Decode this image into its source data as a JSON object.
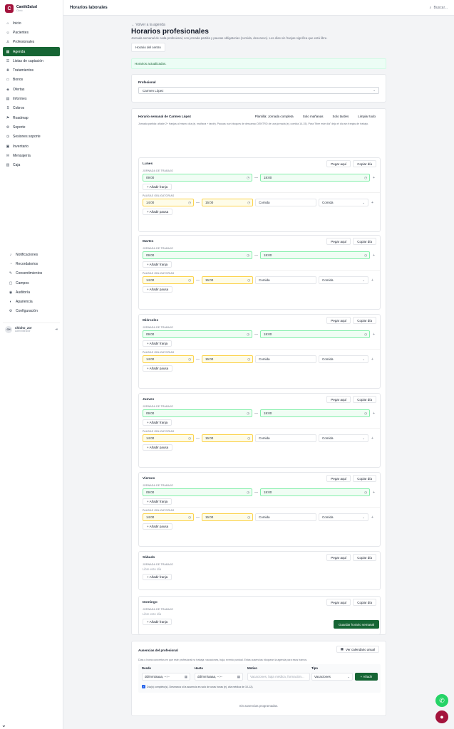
{
  "brand": {
    "name": "CantikSalud",
    "sub": "Clínic"
  },
  "nav": [
    {
      "label": "Inicio",
      "icon": "⌂",
      "name": "home"
    },
    {
      "label": "Pacientes",
      "icon": "☺",
      "name": "pacientes"
    },
    {
      "label": "Profesionales",
      "icon": "♙",
      "name": "profesionales"
    },
    {
      "label": "Agenda",
      "icon": "▦",
      "name": "agenda",
      "active": true
    },
    {
      "label": "Listas de captación",
      "icon": "☰",
      "name": "listas"
    },
    {
      "label": "Tratamientos",
      "icon": "✚",
      "name": "tratamientos"
    },
    {
      "label": "Bonos",
      "icon": "▭",
      "name": "bonos"
    },
    {
      "label": "Ofertas",
      "icon": "◈",
      "name": "ofertas"
    },
    {
      "label": "Informes",
      "icon": "▤",
      "name": "informes"
    },
    {
      "label": "Cobros",
      "icon": "$",
      "name": "cobros"
    },
    {
      "label": "Roadmap",
      "icon": "⚑",
      "name": "roadmap"
    },
    {
      "label": "Soporte",
      "icon": "⚙",
      "name": "soporte"
    },
    {
      "label": "Sesiones soporte",
      "icon": "◷",
      "name": "sesiones-soporte"
    },
    {
      "label": "Inventario",
      "icon": "▣",
      "name": "inventario"
    },
    {
      "label": "Mensajería",
      "icon": "✉",
      "name": "mensajeria"
    },
    {
      "label": "Caja",
      "icon": "▥",
      "name": "caja"
    }
  ],
  "nav2": [
    {
      "label": "Notificaciones",
      "icon": "♪",
      "name": "notificaciones"
    },
    {
      "label": "Recordatorios",
      "icon": "◔",
      "name": "recordatorios"
    },
    {
      "label": "Consentimientos",
      "icon": "✎",
      "name": "consentimientos"
    },
    {
      "label": "Campos",
      "icon": "▢",
      "name": "campos"
    },
    {
      "label": "Auditoría",
      "icon": "◉",
      "name": "auditoria"
    },
    {
      "label": "Apariencia",
      "icon": "◐",
      "name": "apariencia"
    },
    {
      "label": "Configuración",
      "icon": "⚙",
      "name": "configuracion"
    }
  ],
  "user": {
    "initials": "CH",
    "name": "chicho_zor",
    "role": "Administrador"
  },
  "topbar": {
    "title": "Horarios laborales",
    "search": "Buscar..."
  },
  "page": {
    "back": "← Volver a la agenda",
    "title": "Horarios profesionales",
    "subtitle": "Jornada semanal de cada profesional, con jornada partida y pausas obligatorias (comida, descanso). Los días sin franjas significa que está libre.",
    "tab": "Horario del centro",
    "alert": "Horarios actualizados."
  },
  "profesional": {
    "label": "Profesional",
    "value": "Carmen López"
  },
  "schedule": {
    "title": "Horario semanal de Carmen López",
    "desc": "Jornada partida: añade 2+ franjas al mismo día (ej. mañana + tarde). Pausas: son bloques de descanso DENTRO de una jornada (ej. comida 14-15). Para \"libre este día\" deja el día sin franjas de trabajo.",
    "buttons": {
      "template": "Plantilla: Jornada completa",
      "morning": "Solo mañanas",
      "afternoon": "Solo tardes",
      "clear": "Limpiar todo"
    },
    "paste": "Pegar aquí",
    "copy": "Copiar día",
    "work_label": "JORNADA DE TRABAJO",
    "pause_label": "PAUSAS OBLIGATORIAS",
    "add_slot": "+ Añadir franja",
    "add_pause": "+ Añadir pausa",
    "closed": "Libre este día",
    "save": "Guardar horario semanal",
    "days": [
      {
        "name": "Lunes",
        "start": "09:00",
        "end": "18:00",
        "p_start": "14:00",
        "p_end": "15:00",
        "p_reason": "Comida",
        "p_type": "Comida"
      },
      {
        "name": "Martes",
        "start": "09:00",
        "end": "18:00",
        "p_start": "14:00",
        "p_end": "15:00",
        "p_reason": "Comida",
        "p_type": "Comida"
      },
      {
        "name": "Miércoles",
        "start": "09:00",
        "end": "18:00",
        "p_start": "14:00",
        "p_end": "15:00",
        "p_reason": "Comida",
        "p_type": "Comida"
      },
      {
        "name": "Jueves",
        "start": "09:00",
        "end": "18:00",
        "p_start": "14:00",
        "p_end": "15:00",
        "p_reason": "Comida",
        "p_type": "Comida"
      },
      {
        "name": "Viernes",
        "start": "09:00",
        "end": "18:00",
        "p_start": "14:00",
        "p_end": "15:00",
        "p_reason": "Comida",
        "p_type": "Comida"
      },
      {
        "name": "Sábado"
      },
      {
        "name": "Domingo"
      }
    ]
  },
  "absences": {
    "title": "Ausencias del profesional",
    "calendar_btn": "Ver calendario anual",
    "desc": "Días u horas concretos en que este profesional no trabaja: vacaciones, baja, evento puntual. Estas ausencias bloquean la agenda para esos tramos.",
    "from_label": "Desde",
    "to_label": "Hasta",
    "reason_label": "Motivo",
    "type_label": "Tipo",
    "from_placeholder": "dd/mm/aaaa, --:--",
    "to_placeholder": "dd/mm/aaaa, --:--",
    "reason_placeholder": "Vacaciones, baja médica, formación...",
    "type_value": "Vacaciones",
    "add": "+ Añadir",
    "allday": "Día(s) completo(s). Desmarca si la ausencia es solo de unas horas (ej. cita médica de 10-12).",
    "empty": "Sin ausencias programadas."
  },
  "colors": {
    "accent": "#166534",
    "brand": "#a3133c",
    "whatsapp": "#25d366",
    "chat": "#a3133c"
  }
}
